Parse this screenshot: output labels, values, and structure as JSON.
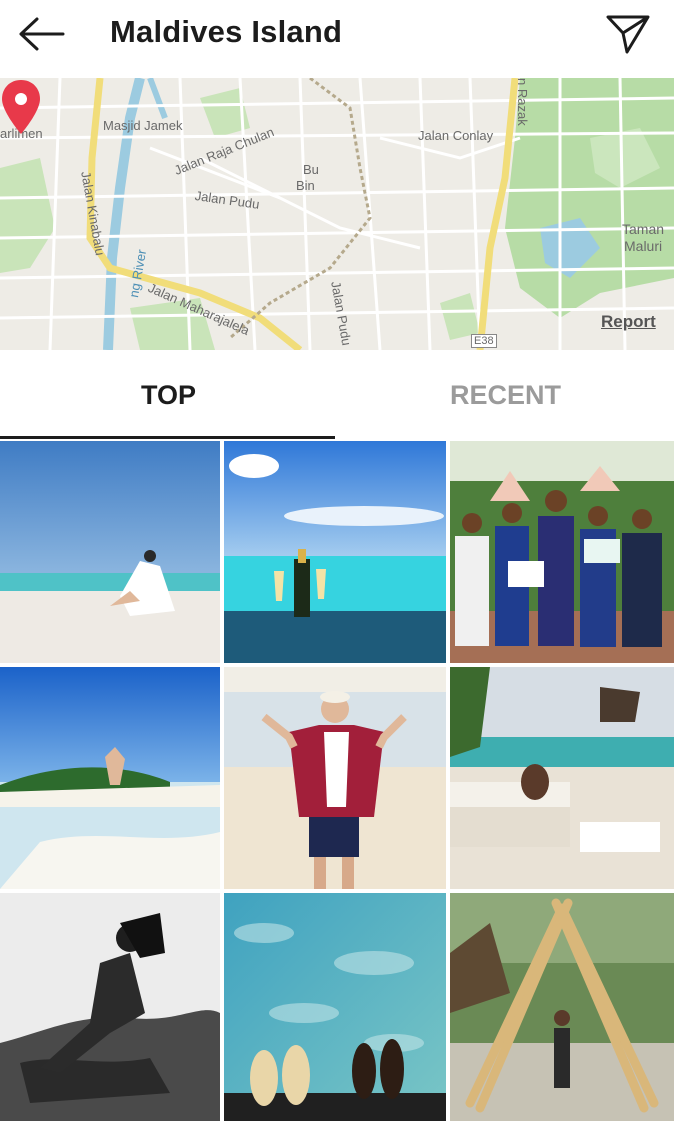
{
  "header": {
    "title": "Maldives Island",
    "back_icon": "arrow-left-icon",
    "share_icon": "paper-plane-icon"
  },
  "map": {
    "labels": {
      "arlimen": "arlimen",
      "masjid_jamek": "Masjid Jamek",
      "jalan_raja_chulan": "Jalan Raja Chulan",
      "jalan_conlay": "Jalan Conlay",
      "jalan_pudu": "Jalan Pudu",
      "jalan_kinabalu": "Jalan Kinabalu",
      "jalan_maharajalela": "Jalan Maharajalela",
      "jalan_pudu_2": "Jalan Pudu",
      "bu": "Bu",
      "bin": "Bin",
      "taman": "Taman",
      "maluri": "Maluri",
      "ng_river": "ng River",
      "n_razak": "n Razak",
      "e38": "E38"
    },
    "report_label": "Report",
    "pin_color": "#e8394a"
  },
  "tabs": [
    {
      "label": "TOP",
      "active": true
    },
    {
      "label": "RECENT",
      "active": false
    }
  ],
  "photos": [
    "couple-on-beach",
    "champagne-infinity-pool",
    "group-with-certificates",
    "person-on-sandbar",
    "man-peace-sign-beach",
    "woman-on-sofa-resort",
    "bw-woman-on-rocks",
    "feet-over-clear-water",
    "bamboo-arch-path"
  ]
}
